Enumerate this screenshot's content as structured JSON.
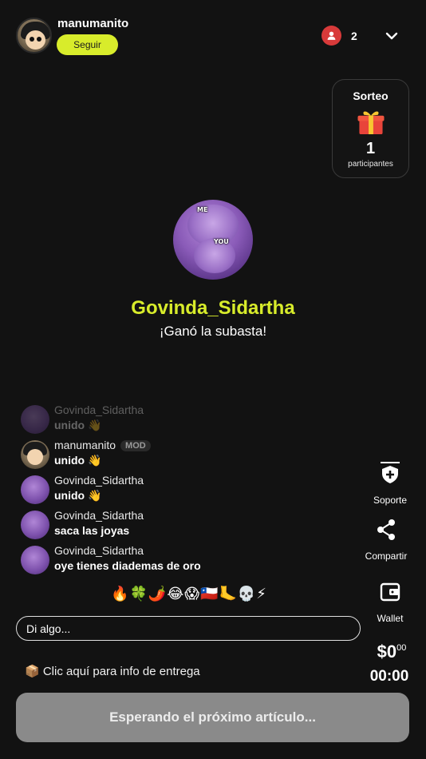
{
  "header": {
    "host_name": "manumanito",
    "follow_label": "Seguir",
    "viewer_count": "2"
  },
  "giveaway": {
    "title": "Sorteo",
    "count": "1",
    "label": "participantes"
  },
  "winner": {
    "avatar_top_text": "ME",
    "avatar_bottom_text": "YOU",
    "name": "Govinda_Sidartha",
    "subtitle": "¡Ganó la subasta!"
  },
  "chat": {
    "messages": [
      {
        "user": "Govinda_Sidartha",
        "text": "unido 👋",
        "faded": true
      },
      {
        "user": "manumanito",
        "badge": "MOD",
        "text": "unido 👋"
      },
      {
        "user": "Govinda_Sidartha",
        "text": "unido 👋"
      },
      {
        "user": "Govinda_Sidartha",
        "text": "saca las joyas"
      },
      {
        "user": "Govinda_Sidartha",
        "text": "oye tienes diademas de oro"
      }
    ],
    "emoji_reactions": "🔥🍀🌶️😂😱🇨🇱🦶💀⚡",
    "input_placeholder": "Di algo..."
  },
  "side_actions": {
    "support_label": "Soporte",
    "share_label": "Compartir",
    "wallet_label": "Wallet"
  },
  "footer": {
    "delivery_text": "📦 Clic aquí para info de entrega",
    "price_main": "$0",
    "price_cents": "00",
    "timer": "00:00",
    "status_button": "Esperando el próximo artículo..."
  },
  "colors": {
    "accent": "#d8ec2b",
    "background": "#121212",
    "viewer_badge": "#d83a3a",
    "status_button": "#8a8a8a"
  }
}
